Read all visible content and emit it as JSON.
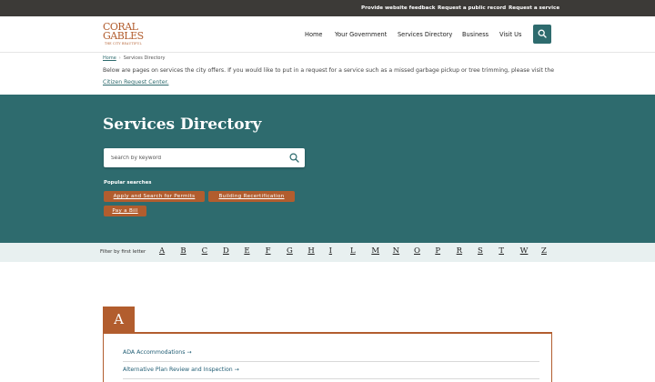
{
  "utility_bar": {
    "links": [
      {
        "label": "Provide website feedback"
      },
      {
        "label": "Request a public record"
      },
      {
        "label": "Request a service"
      }
    ]
  },
  "header": {
    "logo": {
      "line1": "CORAL",
      "line2": "GABLES",
      "tagline": "THE CITY BEAUTIFUL"
    },
    "nav": [
      {
        "label": "Home"
      },
      {
        "label": "Your Government"
      },
      {
        "label": "Services Directory"
      },
      {
        "label": "Business"
      },
      {
        "label": "Visit Us"
      }
    ],
    "search_icon": "search-icon"
  },
  "breadcrumb": {
    "home": "Home",
    "separator": "›",
    "current": "Services Directory"
  },
  "intro": {
    "text": "Below are pages on services the city offers. If you would like to put in a request for a service such as a missed garbage pickup or tree trimming, please visit the ",
    "link": "Citizen Request Center."
  },
  "hero": {
    "title": "Services Directory",
    "search_placeholder": "Search by keyword",
    "popular_label": "Popular searches",
    "popular": [
      {
        "label": "Apply and Search for Permits"
      },
      {
        "label": "Building Recertification"
      },
      {
        "label": "Pay a Bill"
      }
    ]
  },
  "filter": {
    "label": "Filter by first letter",
    "letters": [
      "A",
      "B",
      "C",
      "D",
      "E",
      "F",
      "G",
      "H",
      "I",
      "L",
      "M",
      "N",
      "O",
      "P",
      "R",
      "S",
      "T",
      "W",
      "Z"
    ]
  },
  "section_a": {
    "letter": "A",
    "services": [
      {
        "label": "ADA Accommodations →"
      },
      {
        "label": "Alternative Plan Review and Inspection →"
      }
    ]
  },
  "colors": {
    "teal": "#2e6b6e",
    "copper": "#b25d2e",
    "utility_bg": "#3c3a37",
    "filter_bg": "#e8f0f0"
  }
}
